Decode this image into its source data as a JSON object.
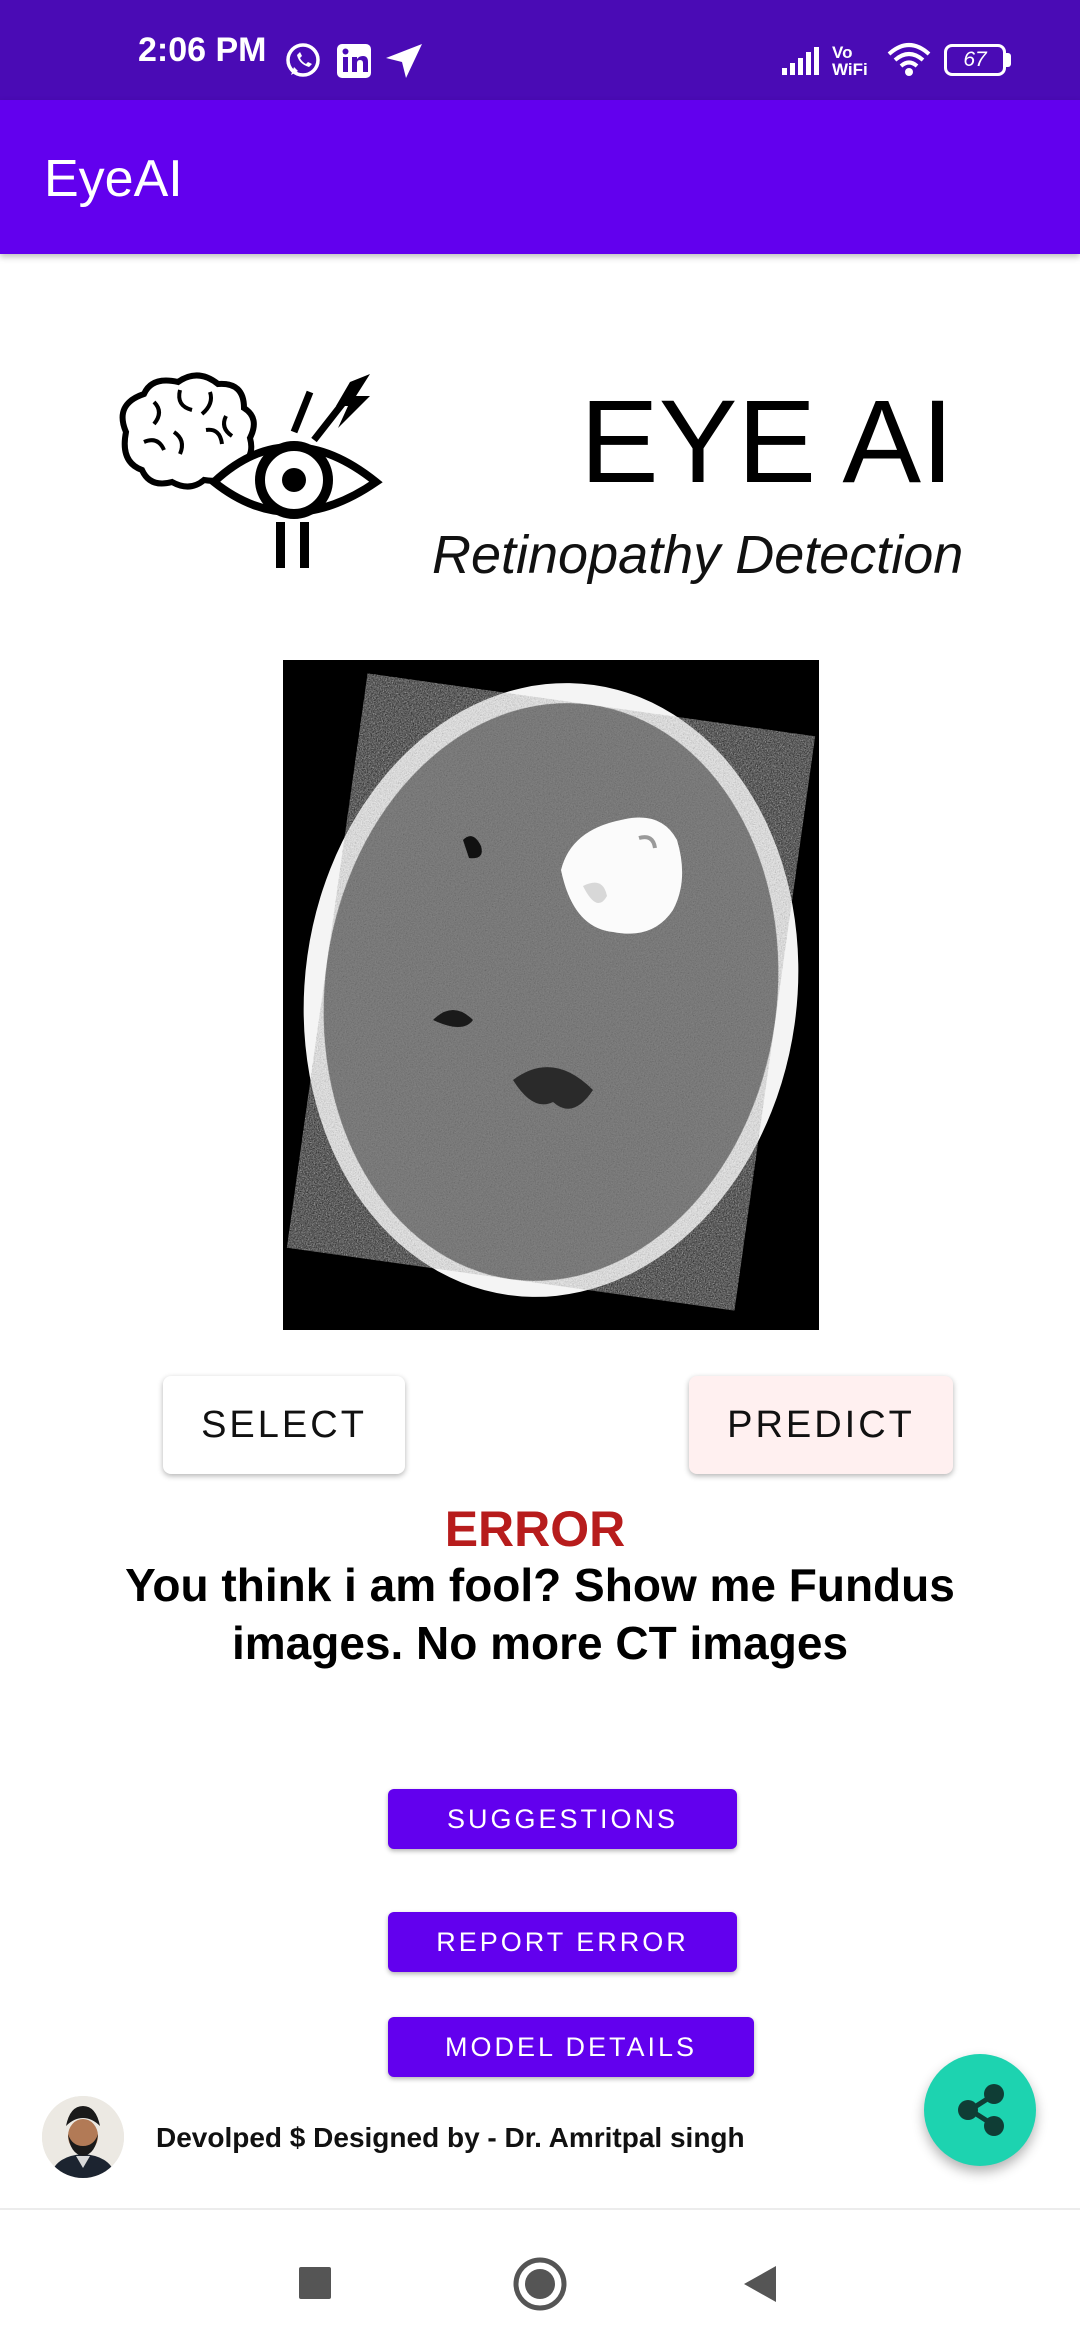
{
  "status_bar": {
    "time": "2:06 PM",
    "battery": "67",
    "network_label": "Vo WiFi",
    "icons": [
      "whatsapp-icon",
      "linkedin-icon",
      "navigation-icon",
      "signal-icon",
      "vowifi-icon",
      "wifi-icon",
      "battery-icon"
    ]
  },
  "app_bar": {
    "title": "EyeAI"
  },
  "header": {
    "title": "EYE AI",
    "subtitle": "Retinopathy Detection",
    "logo_icon": "brain-eye-logo-icon"
  },
  "scan": {
    "kind": "brain-ct-scan-image"
  },
  "actions": {
    "select_label": "SELECT",
    "predict_label": "PREDICT"
  },
  "result": {
    "title": "ERROR",
    "message": "You think i am fool? Show me Fundus images. No more CT images",
    "title_color": "#b71c1c"
  },
  "buttons": {
    "suggestions": "SUGGESTIONS",
    "report_error": "REPORT ERROR",
    "model_details": "MODEL DETAILS"
  },
  "footer": {
    "credit": "Devolped $ Designed by - Dr. Amritpal singh",
    "share_icon": "share-icon"
  },
  "nav_bar": {
    "icons": [
      "recents-square-icon",
      "home-circle-icon",
      "back-triangle-icon"
    ]
  },
  "colors": {
    "status_bar": "#4a0bb5",
    "primary": "#6200ee",
    "fab": "#1dd3b0",
    "error": "#b71c1c"
  }
}
